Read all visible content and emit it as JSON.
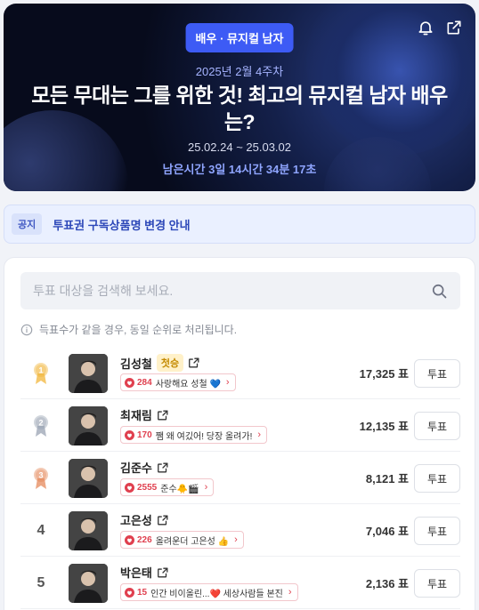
{
  "hero": {
    "category": "배우 · 뮤지컬 남자",
    "week": "2025년 2월 4주차",
    "title": "모든 무대는 그를 위한 것! 최고의 뮤지컬 남자 배우는?",
    "period": "25.02.24 ~ 25.03.02",
    "remaining": "남은시간 3일 14시간 34분 17초",
    "icons": [
      "bell-icon",
      "share-icon"
    ]
  },
  "notice": {
    "tag": "공지",
    "text": "투표권 구독상품명 변경 안내"
  },
  "search": {
    "placeholder": "투표 대상을 검색해 보세요."
  },
  "info_text": "득표수가 같을 경우, 동일 순위로 처리됩니다.",
  "candidates": [
    {
      "rank": "1",
      "name": "김성철",
      "badge": "첫승",
      "cheer_count": "284",
      "cheer_text": "사랑해요 성철 💙",
      "votes": "17,325 표",
      "vote_label": "투표",
      "medal": "#f2b53a"
    },
    {
      "rank": "2",
      "name": "최재림",
      "badge": "",
      "cheer_count": "170",
      "cheer_text": "쨈 왜 여깄어! 당장 올려가!",
      "votes": "12,135 표",
      "vote_label": "투표",
      "medal": "#9aa3b3"
    },
    {
      "rank": "3",
      "name": "김준수",
      "badge": "",
      "cheer_count": "2555",
      "cheer_text": "준수🐥🎬",
      "votes": "8,121 표",
      "vote_label": "투표",
      "medal": "#e58a5c"
    },
    {
      "rank": "4",
      "name": "고은성",
      "badge": "",
      "cheer_count": "226",
      "cheer_text": "올려운더 고은성 👍",
      "votes": "7,046 표",
      "vote_label": "투표",
      "medal": ""
    },
    {
      "rank": "5",
      "name": "박은태",
      "badge": "",
      "cheer_count": "15",
      "cheer_text": "인간 비이올린...❤️ 세상사람들 본진",
      "votes": "2,136 표",
      "vote_label": "투표",
      "medal": ""
    }
  ]
}
